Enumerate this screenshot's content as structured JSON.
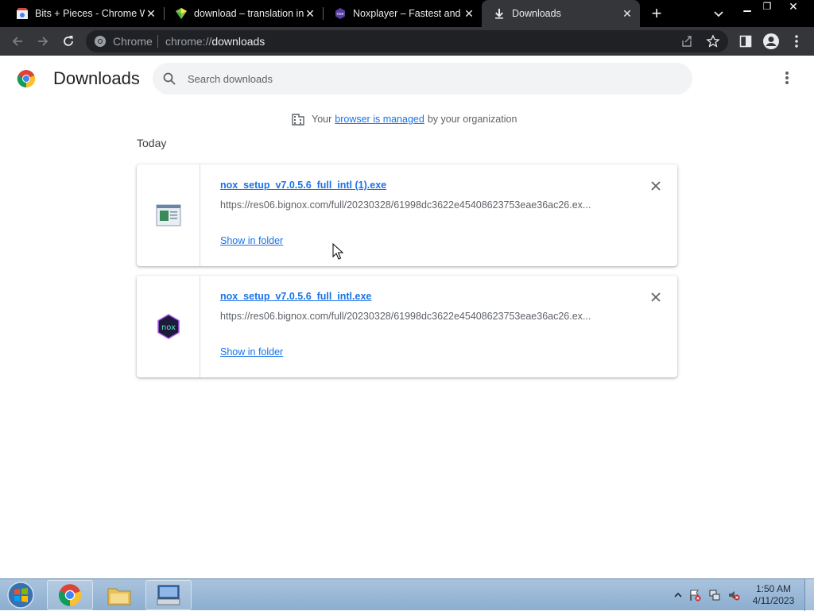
{
  "tabs": [
    {
      "title": "Bits + Pieces - Chrome Web Store",
      "icon": "chrome-web-store-icon"
    },
    {
      "title": "download – translation in",
      "icon": "translate-site-icon"
    },
    {
      "title": "Noxplayer – Fastest and Smoothest",
      "icon": "nox-icon"
    },
    {
      "title": "Downloads",
      "icon": "download-icon"
    }
  ],
  "omnibox": {
    "chip": "Chrome",
    "scheme": "chrome://",
    "path": "downloads"
  },
  "page": {
    "title": "Downloads",
    "search_placeholder": "Search downloads",
    "managed": {
      "prefix": "Your",
      "link": "browser is managed",
      "suffix": "by your organization"
    },
    "section_date": "Today"
  },
  "downloads": [
    {
      "filename": "nox_setup_v7.0.5.6_full_intl (1).exe",
      "url": "https://res06.bignox.com/full/20230328/61998dc3622e45408623753eae36ac26.ex...",
      "action": "Show in folder",
      "icon": "exe-file-icon"
    },
    {
      "filename": "nox_setup_v7.0.5.6_full_intl.exe",
      "url": "https://res06.bignox.com/full/20230328/61998dc3622e45408623753eae36ac26.ex...",
      "action": "Show in folder",
      "icon": "nox-app-icon"
    }
  ],
  "taskbar": {
    "time": "1:50 AM",
    "date": "4/11/2023"
  },
  "colors": {
    "link": "#1a73e8",
    "tabbar": "#000000",
    "toolbar": "#35363a",
    "taskbar": "#9ab8d6"
  }
}
